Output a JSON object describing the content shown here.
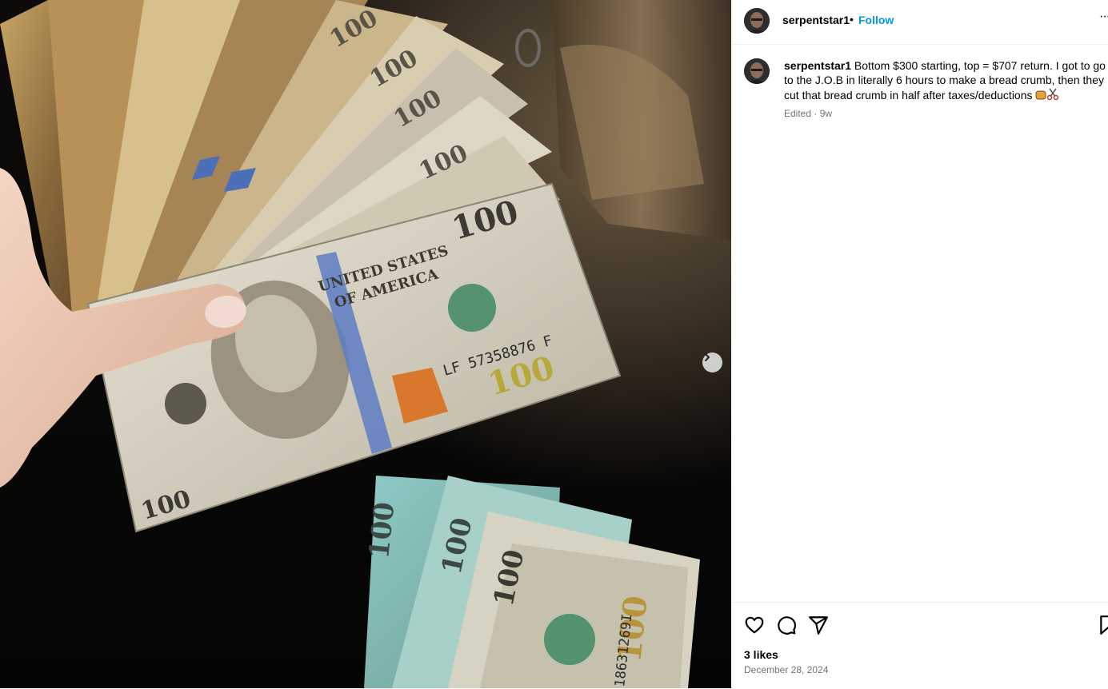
{
  "post": {
    "username": "serpentstar1",
    "separator": "•",
    "follow_label": "Follow",
    "more_label": "···",
    "caption_username": "serpentstar1",
    "caption_text": " Bottom $300 starting, top = $707 return. I got to go to the J.O.B in literally 6 hours to make a bread crumb, then they cut that bread crumb in half after taxes/deductions ",
    "edited_label": "Edited",
    "meta_separator": " · ",
    "age": "9w",
    "likes": "3 likes",
    "date": "December 28, 2024"
  },
  "media": {
    "banknote_denomination": "100",
    "serial_1": "LF 57358876 F",
    "serial_2": "18631269I",
    "next_icon": "chevron-right-icon"
  },
  "icons": {
    "like": "heart-icon",
    "comment": "comment-icon",
    "share": "send-icon",
    "save": "bookmark-icon"
  },
  "colors": {
    "accent": "#0095f6",
    "muted": "#737373",
    "divider": "#efefef"
  }
}
